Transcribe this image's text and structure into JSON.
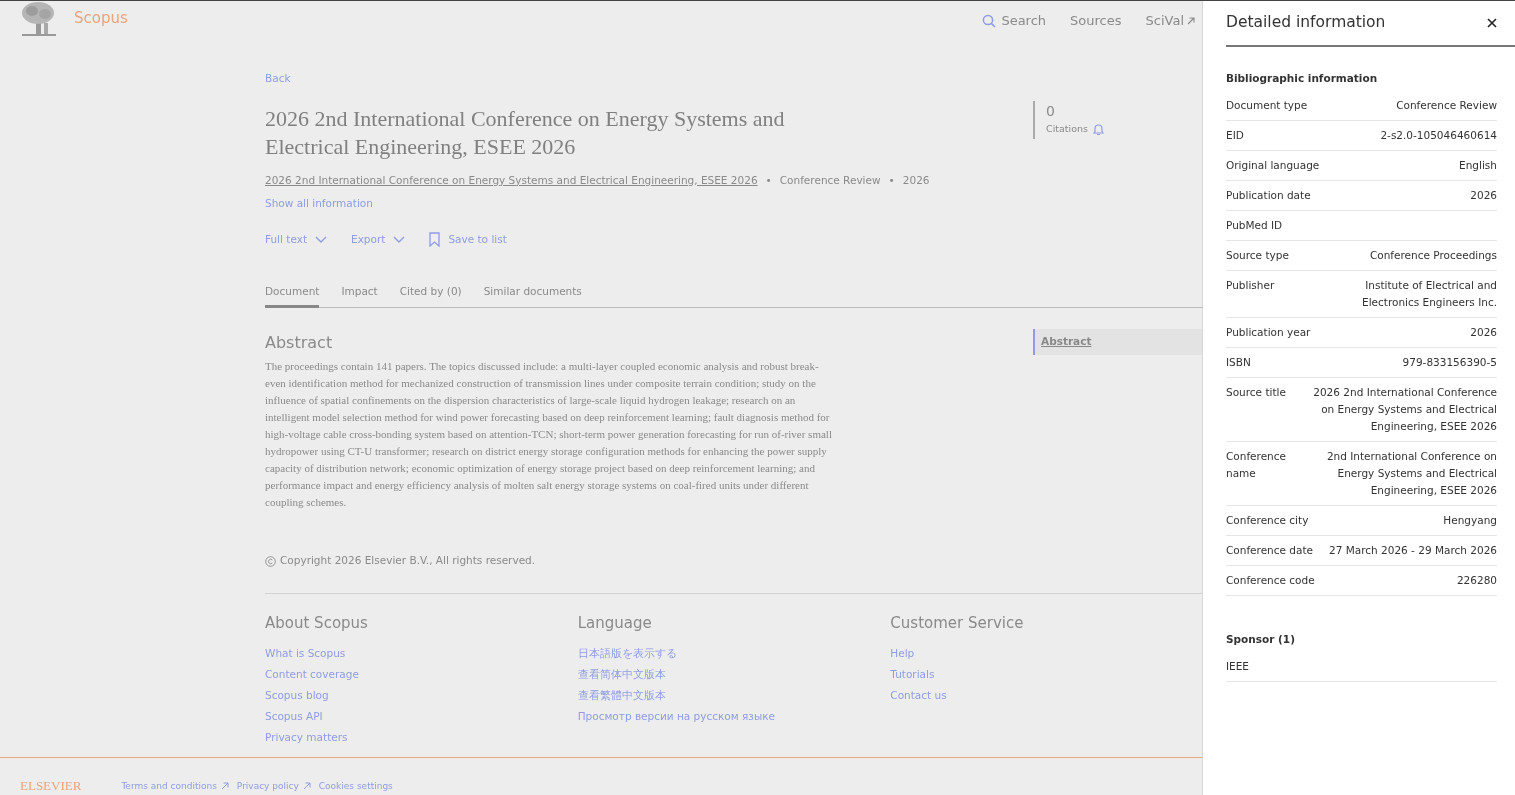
{
  "header": {
    "brand": "Scopus",
    "nav": [
      {
        "label": "Search",
        "kind": "search"
      },
      {
        "label": "Sources",
        "kind": "plain"
      },
      {
        "label": "SciVal",
        "kind": "external"
      }
    ]
  },
  "back": "Back",
  "document": {
    "title": "2026 2nd International Conference on Energy Systems and Electrical Engineering, ESEE 2026",
    "source": "2026 2nd International Conference on Energy Systems and Electrical Engineering, ESEE 2026",
    "doc_type": "Conference Review",
    "year": "2026",
    "separators": [
      "•",
      "•"
    ],
    "show_all": "Show all information"
  },
  "actions": [
    {
      "label": "Full text",
      "kind": "dropdown"
    },
    {
      "label": "Export",
      "kind": "dropdown"
    },
    {
      "label": "Save to list",
      "kind": "bookmark"
    }
  ],
  "citations": {
    "count": "0",
    "label": "Citations"
  },
  "tabs": [
    {
      "label": "Document",
      "selected": true
    },
    {
      "label": "Impact",
      "selected": false
    },
    {
      "label": "Cited by (0)",
      "selected": false
    },
    {
      "label": "Similar documents",
      "selected": false
    }
  ],
  "abstract": {
    "heading": "Abstract",
    "text": "The proceedings contain 141 papers. The topics discussed include: a multi-layer coupled economic analysis and robust break-even identification method for mechanized construction of transmission lines under composite terrain condition; study on the influence of spatial confinements on the dispersion characteristics of large-scale liquid hydrogen leakage; research on an intelligent model selection method for wind power forecasting based on deep reinforcement learning; fault diagnosis method for high-voltage cable cross-bonding system based on attention-TCN; short-term power generation forecasting for run of-river small hydropower using CT-U transformer; research on district energy storage configuration methods for enhancing the power supply capacity of distribution network; economic optimization of energy storage project based on deep reinforcement learning; and performance impact and energy efficiency analysis of molten salt energy storage systems on coal-fired units under different coupling schemes."
  },
  "outline": [
    {
      "label": "Abstract",
      "selected": true
    }
  ],
  "copyright": "Copyright 2026 Elsevier B.V., All rights reserved.",
  "footer": {
    "columns": [
      {
        "heading": "About Scopus",
        "links": [
          "What is Scopus",
          "Content coverage",
          "Scopus blog",
          "Scopus API",
          "Privacy matters"
        ]
      },
      {
        "heading": "Language",
        "links": [
          "日本語版を表示する",
          "查看简体中文版本",
          "查看繁體中文版本",
          "Просмотр версии на русском языке"
        ]
      },
      {
        "heading": "Customer Service",
        "links": [
          "Help",
          "Tutorials",
          "Contact us"
        ]
      }
    ]
  },
  "bottom_bar": {
    "brand": "ELSEVIER",
    "links": [
      {
        "label": "Terms and conditions",
        "external": true
      },
      {
        "label": "Privacy policy",
        "external": true
      },
      {
        "label": "Cookies settings",
        "external": false
      }
    ]
  },
  "drawer": {
    "title": "Detailed information",
    "section": "Bibliographic information",
    "rows": [
      {
        "label": "Document type",
        "value": "Conference Review"
      },
      {
        "label": "EID",
        "value": "2-s2.0-105046460614"
      },
      {
        "label": "Original language",
        "value": "English"
      },
      {
        "label": "Publication date",
        "value": "2026"
      },
      {
        "label": "PubMed ID"
      },
      {
        "label": "Source type",
        "value": "Conference Proceedings"
      },
      {
        "label": "Publisher",
        "value": "Institute of Electrical and Electronics Engineers Inc."
      },
      {
        "label": "Publication year",
        "value": "2026"
      },
      {
        "label": "ISBN",
        "value": "979-833156390-5"
      },
      {
        "label": "Source title",
        "value": "2026 2nd International Conference on Energy Systems and Electrical Engineering, ESEE 2026"
      },
      {
        "label": "Conference name",
        "value": "2nd International Conference on Energy Systems and Electrical Engineering, ESEE 2026"
      },
      {
        "label": "Conference city",
        "value": "Hengyang"
      },
      {
        "label": "Conference date",
        "value": "27 March 2026 - 29 March 2026"
      },
      {
        "label": "Conference code",
        "value": "226280"
      }
    ],
    "sponsor_heading": "Sponsor (1)",
    "sponsors": [
      "IEEE"
    ]
  }
}
